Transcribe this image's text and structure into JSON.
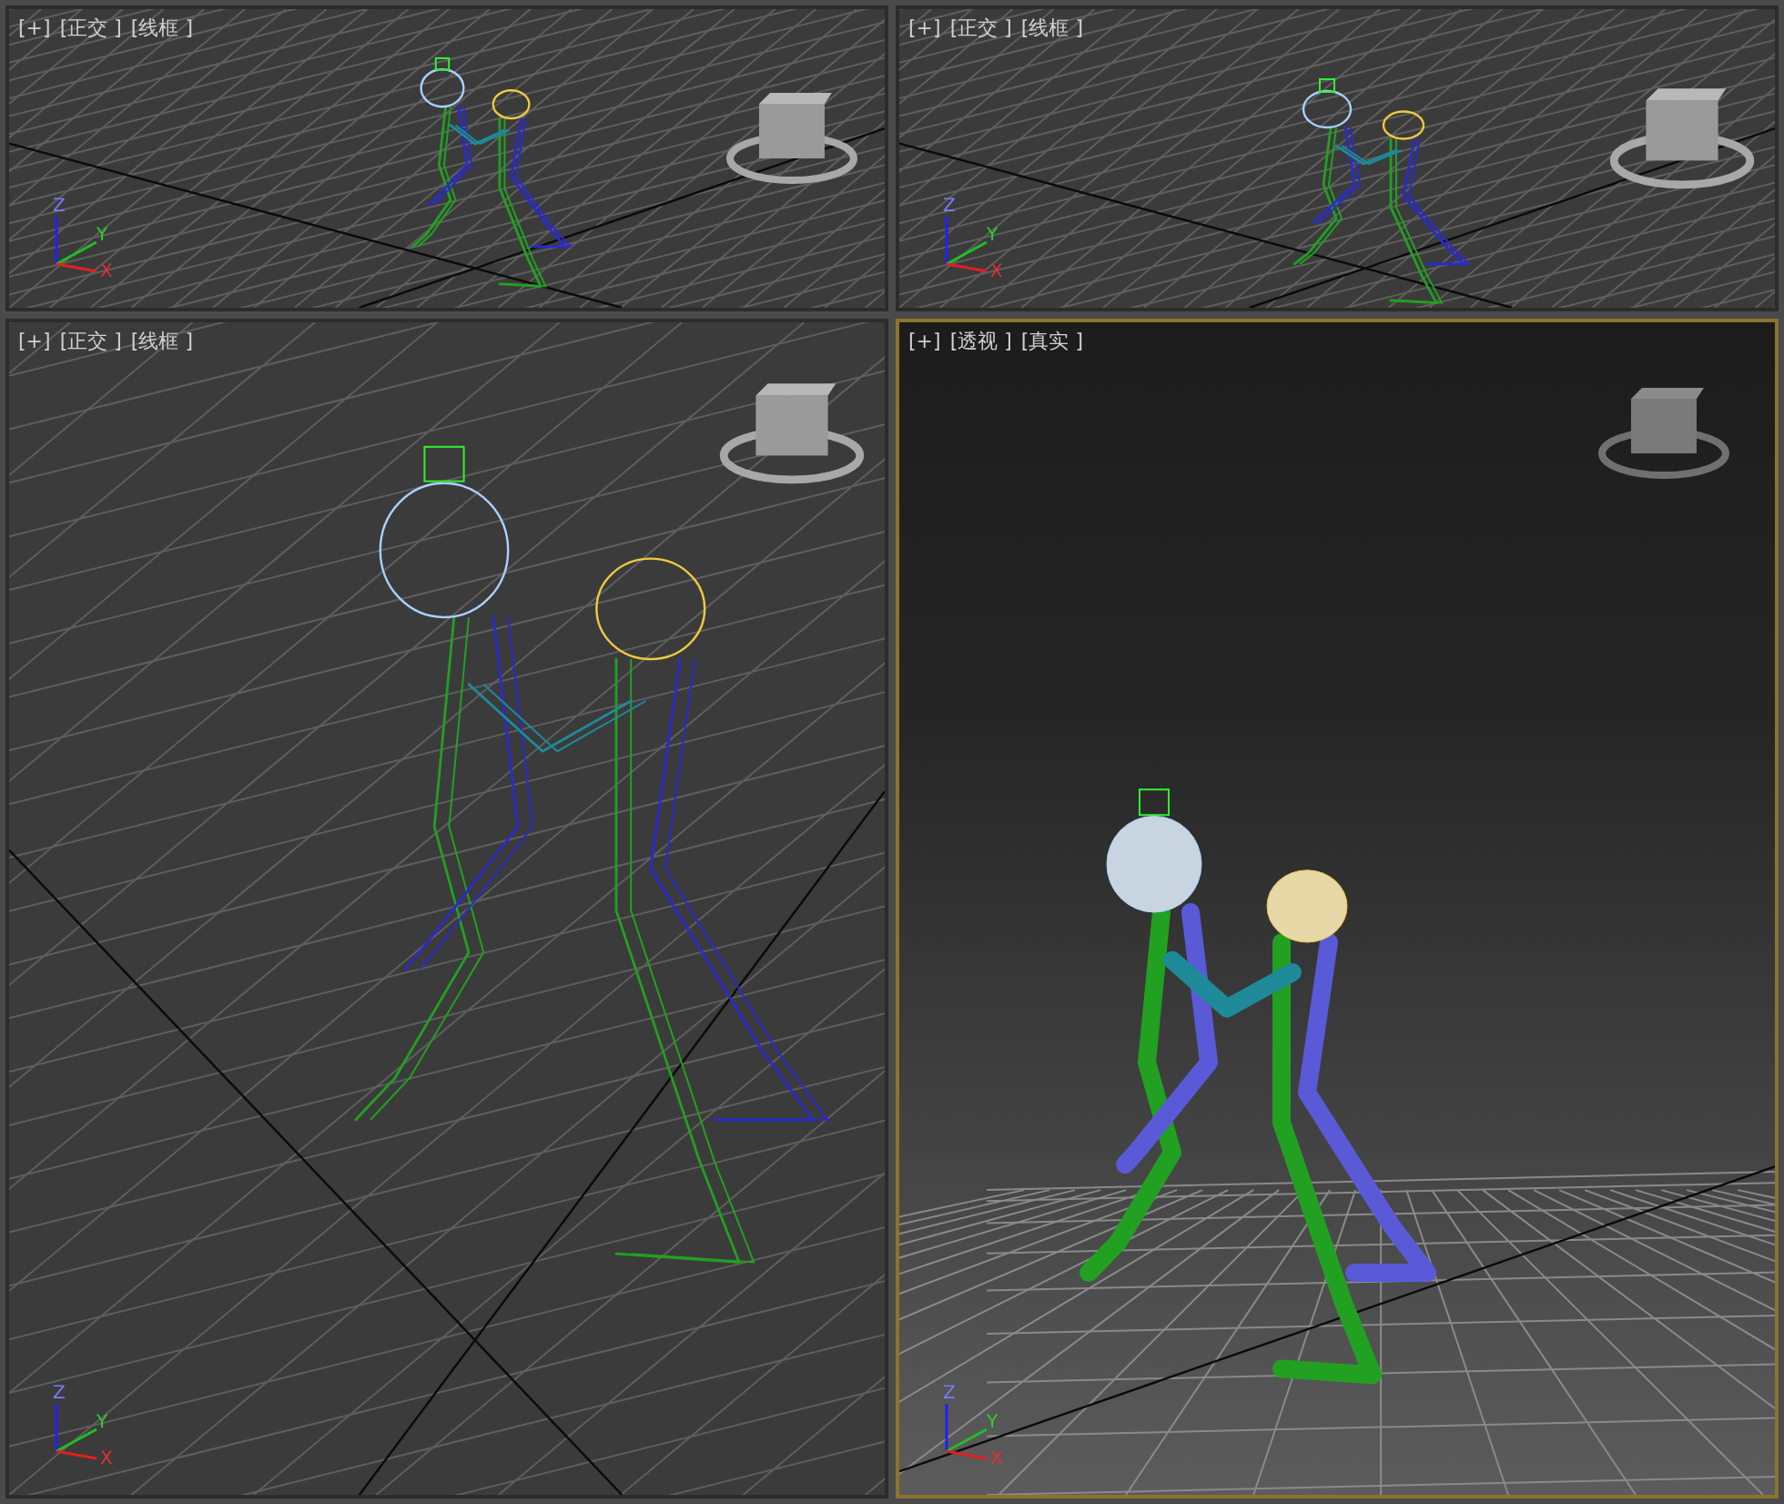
{
  "viewports": [
    {
      "menu": "[+]",
      "view": "[正交 ]",
      "shading": "[线框 ]",
      "kind": "wireframe",
      "selected": false,
      "axes": {
        "x": "X",
        "y": "Y",
        "z": "Z"
      }
    },
    {
      "menu": "[+]",
      "view": "[正交 ]",
      "shading": "[线框 ]",
      "kind": "wireframe",
      "selected": false,
      "axes": {
        "x": "X",
        "y": "Y",
        "z": "Z"
      }
    },
    {
      "menu": "[+]",
      "view": "[正交 ]",
      "shading": "[线框 ]",
      "kind": "wireframe",
      "selected": false,
      "axes": {
        "x": "X",
        "y": "Y",
        "z": "Z"
      }
    },
    {
      "menu": "[+]",
      "view": "[透视 ]",
      "shading": "[真实 ]",
      "kind": "shaded",
      "selected": true,
      "axes": {
        "x": "X",
        "y": "Y",
        "z": "Z"
      }
    }
  ]
}
